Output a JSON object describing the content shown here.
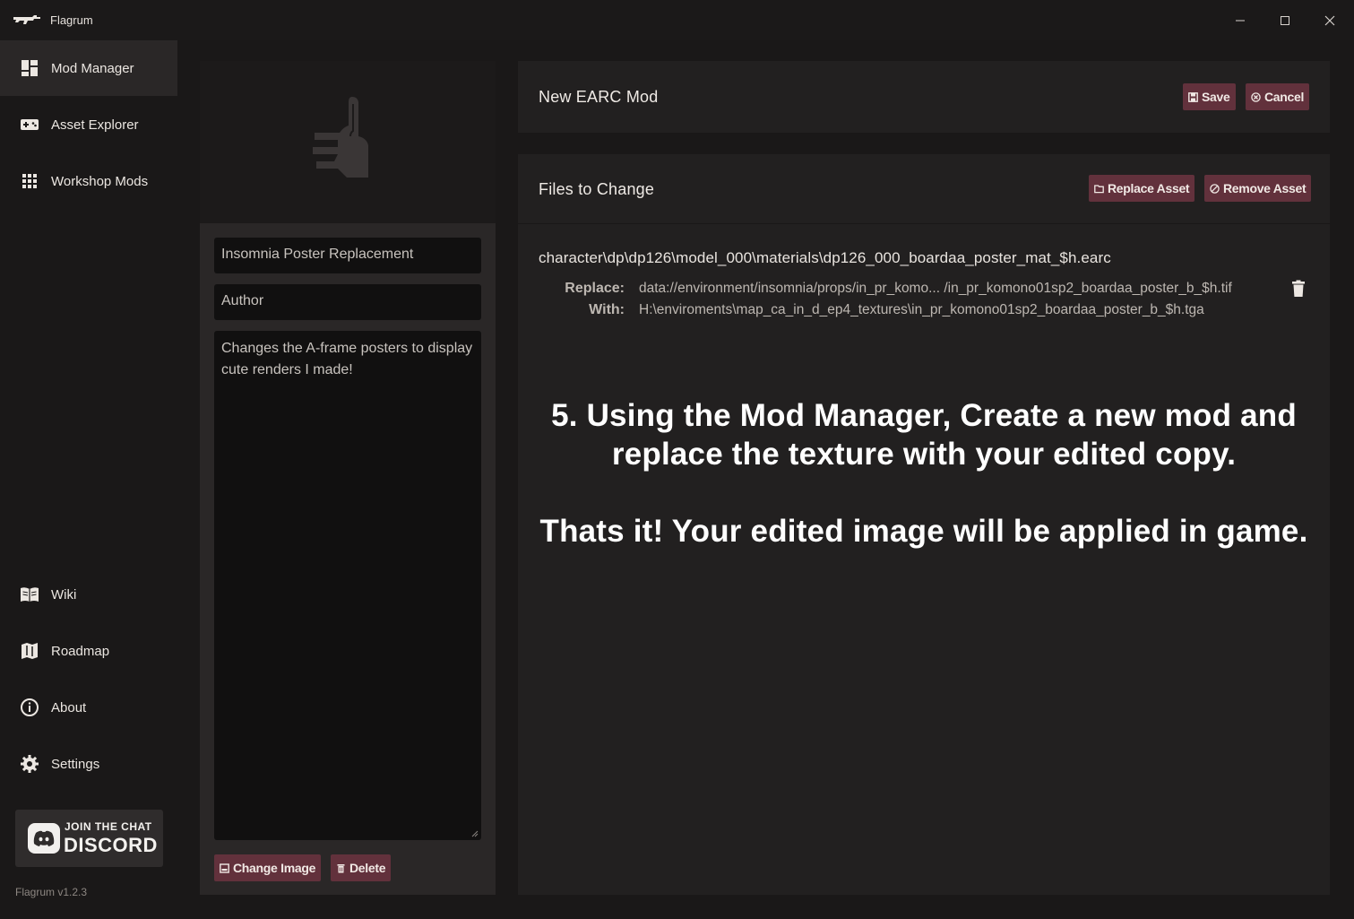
{
  "app": {
    "title": "Flagrum",
    "version": "Flagrum v1.2.3"
  },
  "colors": {
    "accent": "#62313c",
    "background": "#1a1818",
    "panel": "#222020",
    "input": "#111010"
  },
  "sidebar": {
    "top_items": [
      {
        "label": "Mod Manager",
        "icon": "dashboard-icon",
        "active": true
      },
      {
        "label": "Asset Explorer",
        "icon": "gamepad-icon",
        "active": false
      },
      {
        "label": "Workshop Mods",
        "icon": "grid-icon",
        "active": false
      }
    ],
    "bottom_items": [
      {
        "label": "Wiki",
        "icon": "book-icon"
      },
      {
        "label": "Roadmap",
        "icon": "map-icon"
      },
      {
        "label": "About",
        "icon": "info-icon"
      },
      {
        "label": "Settings",
        "icon": "gear-icon"
      }
    ],
    "discord": {
      "line1": "JOIN THE CHAT",
      "line2": "DISCORD"
    }
  },
  "mod_form": {
    "name_value": "Insomnia Poster Replacement",
    "author_placeholder": "Author",
    "description_value": "Changes the A-frame posters to display cute renders I made!",
    "change_image_label": "Change Image",
    "delete_label": "Delete"
  },
  "header": {
    "title": "New EARC Mod",
    "save_label": "Save",
    "cancel_label": "Cancel"
  },
  "files": {
    "title": "Files to Change",
    "replace_asset_label": "Replace Asset",
    "remove_asset_label": "Remove Asset",
    "entries": [
      {
        "path": "character\\dp\\dp126\\model_000\\materials\\dp126_000_boardaa_poster_mat_$h.earc",
        "replace_label": "Replace:",
        "replace_value": "data://environment/insomnia/props/in_pr_komo... /in_pr_komono01sp2_boardaa_poster_b_$h.tif",
        "with_label": "With:",
        "with_value": "H:\\enviroments\\map_ca_in_d_ep4_textures\\in_pr_komono01sp2_boardaa_poster_b_$h.tga"
      }
    ]
  },
  "instructions": {
    "line1": "5. Using the Mod Manager, Create a new mod and",
    "line2": "replace the texture with your edited copy.",
    "line3": "Thats it! Your edited image will be applied in game."
  }
}
